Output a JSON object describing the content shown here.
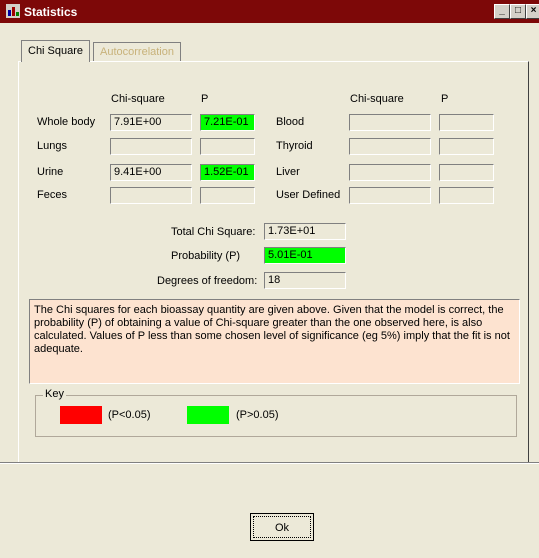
{
  "window": {
    "title": "Statistics",
    "minimize": "_",
    "maximize": "□",
    "close": "×"
  },
  "tabs": [
    {
      "label": "Chi Square"
    },
    {
      "label": "Autocorrelation"
    }
  ],
  "headers": {
    "chi": "Chi-square",
    "p": "P"
  },
  "left_rows": [
    {
      "label": "Whole body",
      "chi": "7.91E+00",
      "p": "7.21E-01"
    },
    {
      "label": "Lungs",
      "chi": "",
      "p": ""
    },
    {
      "label": "Urine",
      "chi": "9.41E+00",
      "p": "1.52E-01"
    },
    {
      "label": "Feces",
      "chi": "",
      "p": ""
    }
  ],
  "right_rows": [
    {
      "label": "Blood",
      "chi": "",
      "p": ""
    },
    {
      "label": "Thyroid",
      "chi": "",
      "p": ""
    },
    {
      "label": "Liver",
      "chi": "",
      "p": ""
    },
    {
      "label": "User Defined",
      "chi": "",
      "p": ""
    }
  ],
  "totals": {
    "total_label": "Total Chi Square:",
    "total_value": "1.73E+01",
    "prob_label": "Probability (P)",
    "prob_value": "5.01E-01",
    "dof_label": "Degrees of freedom:",
    "dof_value": "18"
  },
  "description": "The Chi squares for each bioassay quantity are given above.  Given that the model is correct, the probability (P) of obtaining a value of Chi-square greater than the one observed here, is also calculated.  Values of P less than some chosen level of significance (eg 5%) imply that the fit is not adequate.",
  "key": {
    "title": "Key",
    "items": [
      {
        "color": "#ff0000",
        "label": "(P<0.05)"
      },
      {
        "color": "#00ff00",
        "label": "(P>0.05)"
      }
    ]
  },
  "ok_button": {
    "label": "Ok"
  },
  "colors": {
    "titlebar": "#7d0808",
    "significant": "#00ff00",
    "not_significant": "#ff0000",
    "description_bg": "#fde3d0"
  }
}
